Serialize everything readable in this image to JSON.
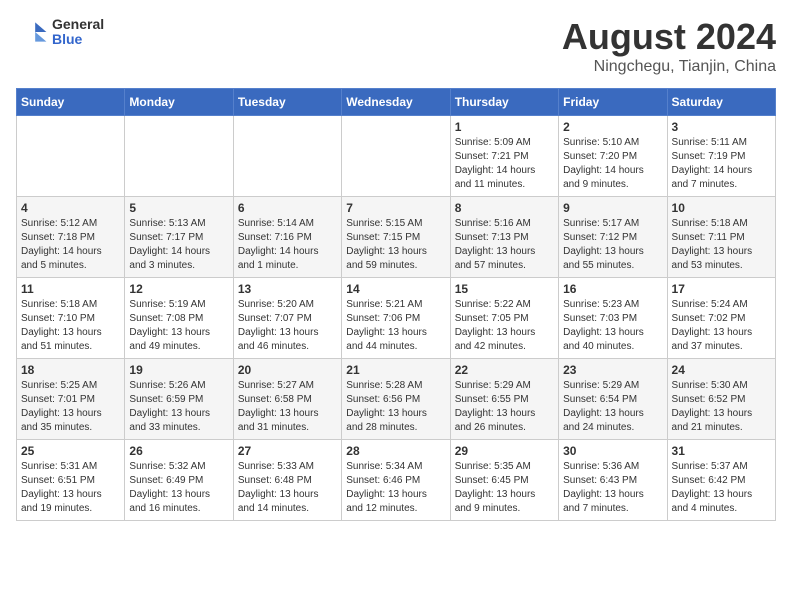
{
  "header": {
    "logo_general": "General",
    "logo_blue": "Blue",
    "title": "August 2024",
    "subtitle": "Ningchegu, Tianjin, China"
  },
  "weekdays": [
    "Sunday",
    "Monday",
    "Tuesday",
    "Wednesday",
    "Thursday",
    "Friday",
    "Saturday"
  ],
  "weeks": [
    [
      {
        "day": "",
        "info": ""
      },
      {
        "day": "",
        "info": ""
      },
      {
        "day": "",
        "info": ""
      },
      {
        "day": "",
        "info": ""
      },
      {
        "day": "1",
        "info": "Sunrise: 5:09 AM\nSunset: 7:21 PM\nDaylight: 14 hours\nand 11 minutes."
      },
      {
        "day": "2",
        "info": "Sunrise: 5:10 AM\nSunset: 7:20 PM\nDaylight: 14 hours\nand 9 minutes."
      },
      {
        "day": "3",
        "info": "Sunrise: 5:11 AM\nSunset: 7:19 PM\nDaylight: 14 hours\nand 7 minutes."
      }
    ],
    [
      {
        "day": "4",
        "info": "Sunrise: 5:12 AM\nSunset: 7:18 PM\nDaylight: 14 hours\nand 5 minutes."
      },
      {
        "day": "5",
        "info": "Sunrise: 5:13 AM\nSunset: 7:17 PM\nDaylight: 14 hours\nand 3 minutes."
      },
      {
        "day": "6",
        "info": "Sunrise: 5:14 AM\nSunset: 7:16 PM\nDaylight: 14 hours\nand 1 minute."
      },
      {
        "day": "7",
        "info": "Sunrise: 5:15 AM\nSunset: 7:15 PM\nDaylight: 13 hours\nand 59 minutes."
      },
      {
        "day": "8",
        "info": "Sunrise: 5:16 AM\nSunset: 7:13 PM\nDaylight: 13 hours\nand 57 minutes."
      },
      {
        "day": "9",
        "info": "Sunrise: 5:17 AM\nSunset: 7:12 PM\nDaylight: 13 hours\nand 55 minutes."
      },
      {
        "day": "10",
        "info": "Sunrise: 5:18 AM\nSunset: 7:11 PM\nDaylight: 13 hours\nand 53 minutes."
      }
    ],
    [
      {
        "day": "11",
        "info": "Sunrise: 5:18 AM\nSunset: 7:10 PM\nDaylight: 13 hours\nand 51 minutes."
      },
      {
        "day": "12",
        "info": "Sunrise: 5:19 AM\nSunset: 7:08 PM\nDaylight: 13 hours\nand 49 minutes."
      },
      {
        "day": "13",
        "info": "Sunrise: 5:20 AM\nSunset: 7:07 PM\nDaylight: 13 hours\nand 46 minutes."
      },
      {
        "day": "14",
        "info": "Sunrise: 5:21 AM\nSunset: 7:06 PM\nDaylight: 13 hours\nand 44 minutes."
      },
      {
        "day": "15",
        "info": "Sunrise: 5:22 AM\nSunset: 7:05 PM\nDaylight: 13 hours\nand 42 minutes."
      },
      {
        "day": "16",
        "info": "Sunrise: 5:23 AM\nSunset: 7:03 PM\nDaylight: 13 hours\nand 40 minutes."
      },
      {
        "day": "17",
        "info": "Sunrise: 5:24 AM\nSunset: 7:02 PM\nDaylight: 13 hours\nand 37 minutes."
      }
    ],
    [
      {
        "day": "18",
        "info": "Sunrise: 5:25 AM\nSunset: 7:01 PM\nDaylight: 13 hours\nand 35 minutes."
      },
      {
        "day": "19",
        "info": "Sunrise: 5:26 AM\nSunset: 6:59 PM\nDaylight: 13 hours\nand 33 minutes."
      },
      {
        "day": "20",
        "info": "Sunrise: 5:27 AM\nSunset: 6:58 PM\nDaylight: 13 hours\nand 31 minutes."
      },
      {
        "day": "21",
        "info": "Sunrise: 5:28 AM\nSunset: 6:56 PM\nDaylight: 13 hours\nand 28 minutes."
      },
      {
        "day": "22",
        "info": "Sunrise: 5:29 AM\nSunset: 6:55 PM\nDaylight: 13 hours\nand 26 minutes."
      },
      {
        "day": "23",
        "info": "Sunrise: 5:29 AM\nSunset: 6:54 PM\nDaylight: 13 hours\nand 24 minutes."
      },
      {
        "day": "24",
        "info": "Sunrise: 5:30 AM\nSunset: 6:52 PM\nDaylight: 13 hours\nand 21 minutes."
      }
    ],
    [
      {
        "day": "25",
        "info": "Sunrise: 5:31 AM\nSunset: 6:51 PM\nDaylight: 13 hours\nand 19 minutes."
      },
      {
        "day": "26",
        "info": "Sunrise: 5:32 AM\nSunset: 6:49 PM\nDaylight: 13 hours\nand 16 minutes."
      },
      {
        "day": "27",
        "info": "Sunrise: 5:33 AM\nSunset: 6:48 PM\nDaylight: 13 hours\nand 14 minutes."
      },
      {
        "day": "28",
        "info": "Sunrise: 5:34 AM\nSunset: 6:46 PM\nDaylight: 13 hours\nand 12 minutes."
      },
      {
        "day": "29",
        "info": "Sunrise: 5:35 AM\nSunset: 6:45 PM\nDaylight: 13 hours\nand 9 minutes."
      },
      {
        "day": "30",
        "info": "Sunrise: 5:36 AM\nSunset: 6:43 PM\nDaylight: 13 hours\nand 7 minutes."
      },
      {
        "day": "31",
        "info": "Sunrise: 5:37 AM\nSunset: 6:42 PM\nDaylight: 13 hours\nand 4 minutes."
      }
    ]
  ]
}
